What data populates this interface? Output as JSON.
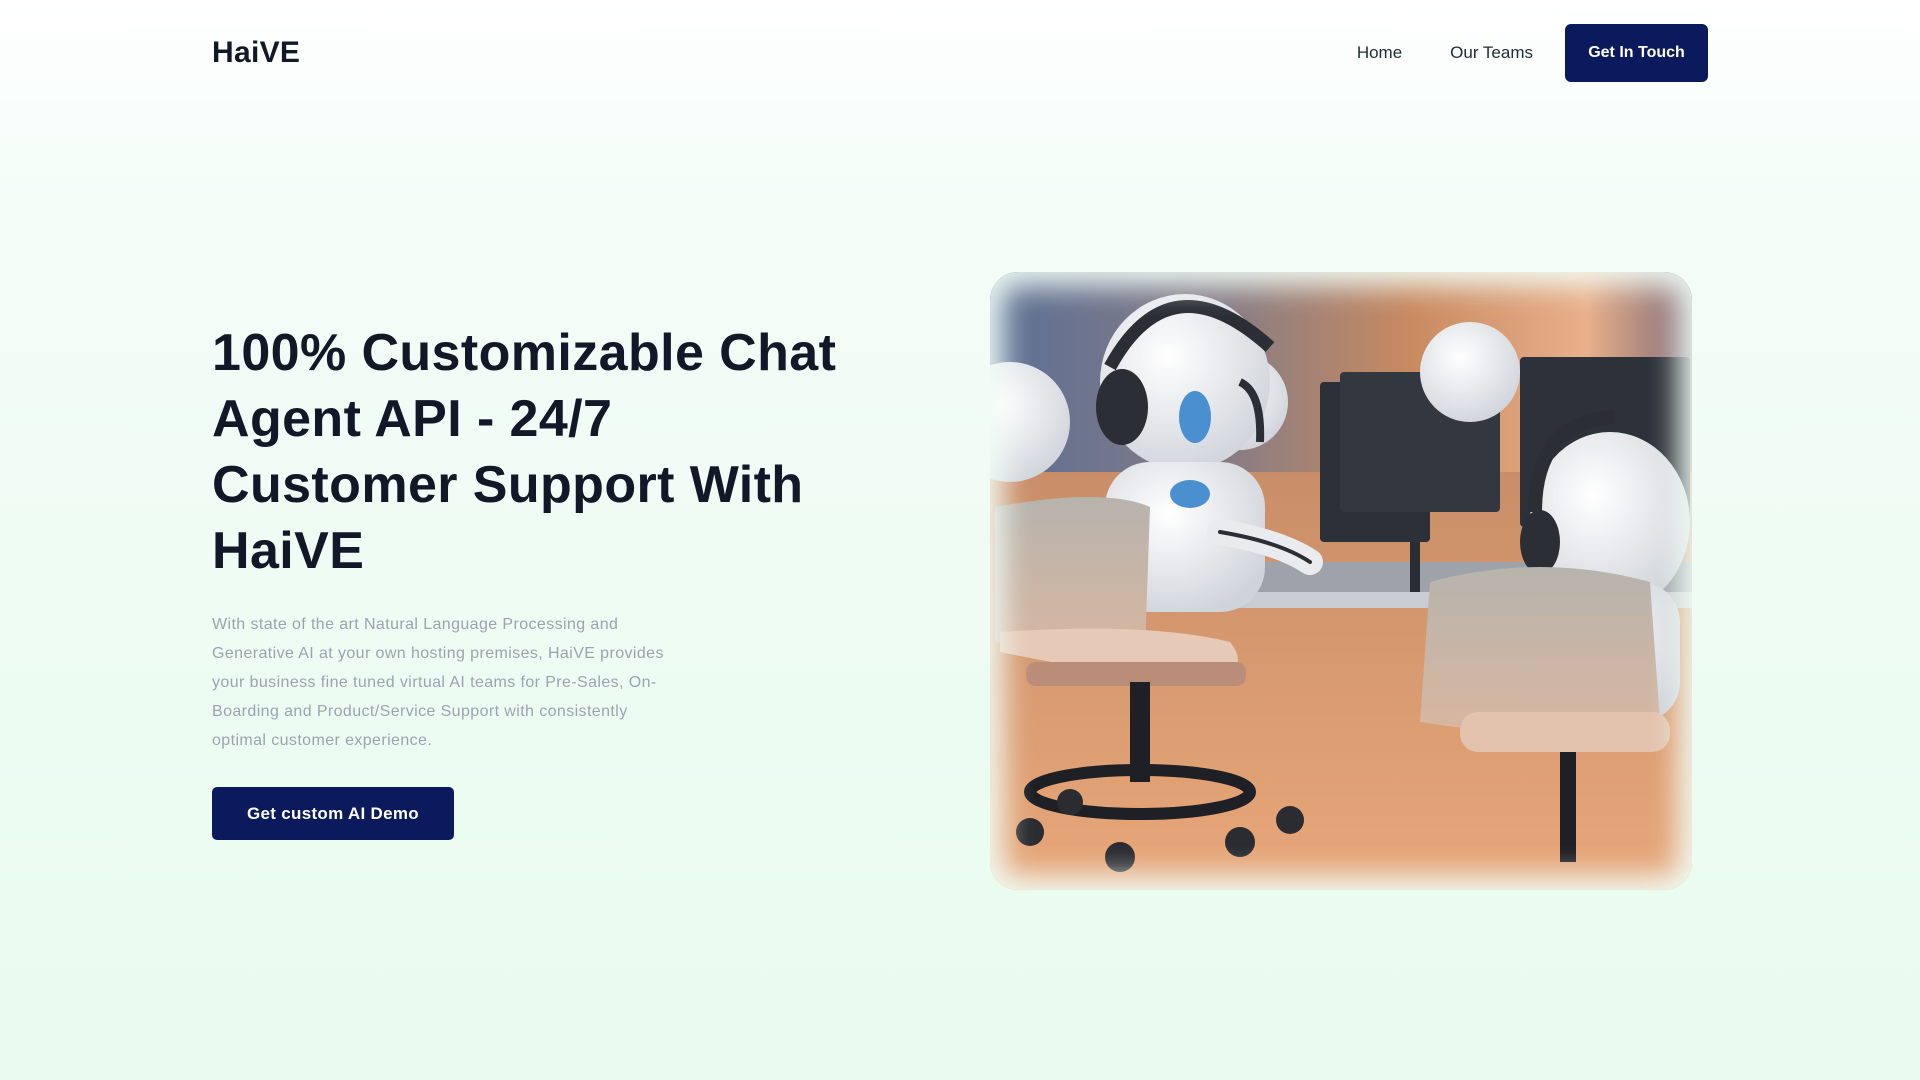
{
  "header": {
    "logo": "HaiVE",
    "nav": {
      "home": "Home",
      "teams": "Our Teams",
      "cta": "Get In Touch"
    }
  },
  "hero": {
    "title": "100% Customizable Chat Agent API - 24/7 Customer Support With HaiVE",
    "description": "With state of the art Natural Language Processing and Generative AI at your own hosting premises, HaiVE provides your business fine tuned virtual AI teams for Pre-Sales, On-Boarding and Product/Service Support with consistently optimal customer experience.",
    "cta": "Get custom AI Demo",
    "image_subject": "robot-call-center-agents-illustration"
  },
  "colors": {
    "primary": "#0b1a5c",
    "heading": "#111827",
    "muted": "#9ca3af",
    "background": "#effcf4"
  }
}
